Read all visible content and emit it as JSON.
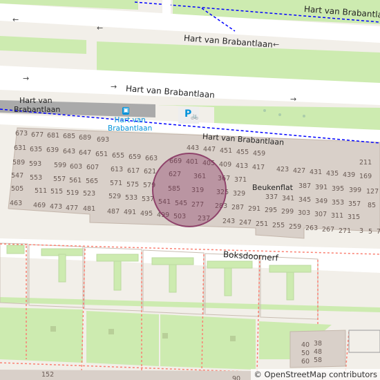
{
  "map": {
    "streets": [
      {
        "id": "top",
        "name": "Hart van Brabantlaan"
      },
      {
        "id": "upper",
        "name": "Hart van Brabantlaan"
      },
      {
        "id": "lower",
        "name": "Hart van Brabantlaan"
      },
      {
        "id": "service",
        "name": "Hart van Brabantlaan"
      },
      {
        "id": "boks",
        "name": "Boksdoornerf"
      }
    ],
    "stop_label": [
      "Hart van",
      "Brabantlaan"
    ],
    "bus_stop_label": [
      "Hart van",
      "Brabantlaan"
    ],
    "building_name": "Beukenflat",
    "parking_symbol": "P",
    "house_numbers": [
      {
        "t": "673"
      },
      {
        "t": "677"
      },
      {
        "t": "681"
      },
      {
        "t": "685"
      },
      {
        "t": "689"
      },
      {
        "t": "693"
      },
      {
        "t": "631"
      },
      {
        "t": "635"
      },
      {
        "t": "639"
      },
      {
        "t": "643"
      },
      {
        "t": "647"
      },
      {
        "t": "651"
      },
      {
        "t": "655"
      },
      {
        "t": "659"
      },
      {
        "t": "663"
      },
      {
        "t": "589"
      },
      {
        "t": "593"
      },
      {
        "t": "599"
      },
      {
        "t": "603"
      },
      {
        "t": "607"
      },
      {
        "t": "613"
      },
      {
        "t": "617"
      },
      {
        "t": "621"
      },
      {
        "t": "547"
      },
      {
        "t": "553"
      },
      {
        "t": "557"
      },
      {
        "t": "561"
      },
      {
        "t": "565"
      },
      {
        "t": "571"
      },
      {
        "t": "575"
      },
      {
        "t": "579"
      },
      {
        "t": "505"
      },
      {
        "t": "511"
      },
      {
        "t": "515"
      },
      {
        "t": "519"
      },
      {
        "t": "523"
      },
      {
        "t": "529"
      },
      {
        "t": "533"
      },
      {
        "t": "537"
      },
      {
        "t": "463"
      },
      {
        "t": "469"
      },
      {
        "t": "473"
      },
      {
        "t": "477"
      },
      {
        "t": "481"
      },
      {
        "t": "487"
      },
      {
        "t": "491"
      },
      {
        "t": "495"
      },
      {
        "t": "499"
      },
      {
        "t": "443"
      },
      {
        "t": "447"
      },
      {
        "t": "451"
      },
      {
        "t": "455"
      },
      {
        "t": "459"
      },
      {
        "t": "669"
      },
      {
        "t": "401"
      },
      {
        "t": "405"
      },
      {
        "t": "409"
      },
      {
        "t": "413"
      },
      {
        "t": "417"
      },
      {
        "t": "627"
      },
      {
        "t": "361"
      },
      {
        "t": "367"
      },
      {
        "t": "371"
      },
      {
        "t": "585"
      },
      {
        "t": "319"
      },
      {
        "t": "325"
      },
      {
        "t": "329"
      },
      {
        "t": "541"
      },
      {
        "t": "545"
      },
      {
        "t": "277"
      },
      {
        "t": "283"
      },
      {
        "t": "287"
      },
      {
        "t": "291"
      },
      {
        "t": "295"
      },
      {
        "t": "299"
      },
      {
        "t": "303"
      },
      {
        "t": "307"
      },
      {
        "t": "311"
      },
      {
        "t": "315"
      },
      {
        "t": "503"
      },
      {
        "t": "237"
      },
      {
        "t": "243"
      },
      {
        "t": "247"
      },
      {
        "t": "251"
      },
      {
        "t": "255"
      },
      {
        "t": "259"
      },
      {
        "t": "263"
      },
      {
        "t": "267"
      },
      {
        "t": "271"
      },
      {
        "t": "423"
      },
      {
        "t": "427"
      },
      {
        "t": "431"
      },
      {
        "t": "435"
      },
      {
        "t": "439"
      },
      {
        "t": "211"
      },
      {
        "t": "169"
      },
      {
        "t": "387"
      },
      {
        "t": "391"
      },
      {
        "t": "395"
      },
      {
        "t": "399"
      },
      {
        "t": "127"
      },
      {
        "t": "337"
      },
      {
        "t": "341"
      },
      {
        "t": "345"
      },
      {
        "t": "349"
      },
      {
        "t": "353"
      },
      {
        "t": "357"
      },
      {
        "t": "85"
      },
      {
        "t": "3"
      },
      {
        "t": "5"
      },
      {
        "t": "7"
      },
      {
        "t": "40"
      },
      {
        "t": "38"
      },
      {
        "t": "50"
      },
      {
        "t": "48"
      },
      {
        "t": "60"
      },
      {
        "t": "58"
      },
      {
        "t": "152"
      },
      {
        "t": "90"
      }
    ],
    "attribution": "© OpenStreetMap contributors",
    "colors": {
      "background": "#f2efe9",
      "road": "#ffffff",
      "green": "#cdebb0",
      "building": "#d9d0c9",
      "building_outline": "#c4b6ab",
      "footway": "#fa8072",
      "path_blue": "#0000ff",
      "marker_fill": "#80285a",
      "parking_blue": "#0092da",
      "rail": "#aaaaaa"
    }
  }
}
